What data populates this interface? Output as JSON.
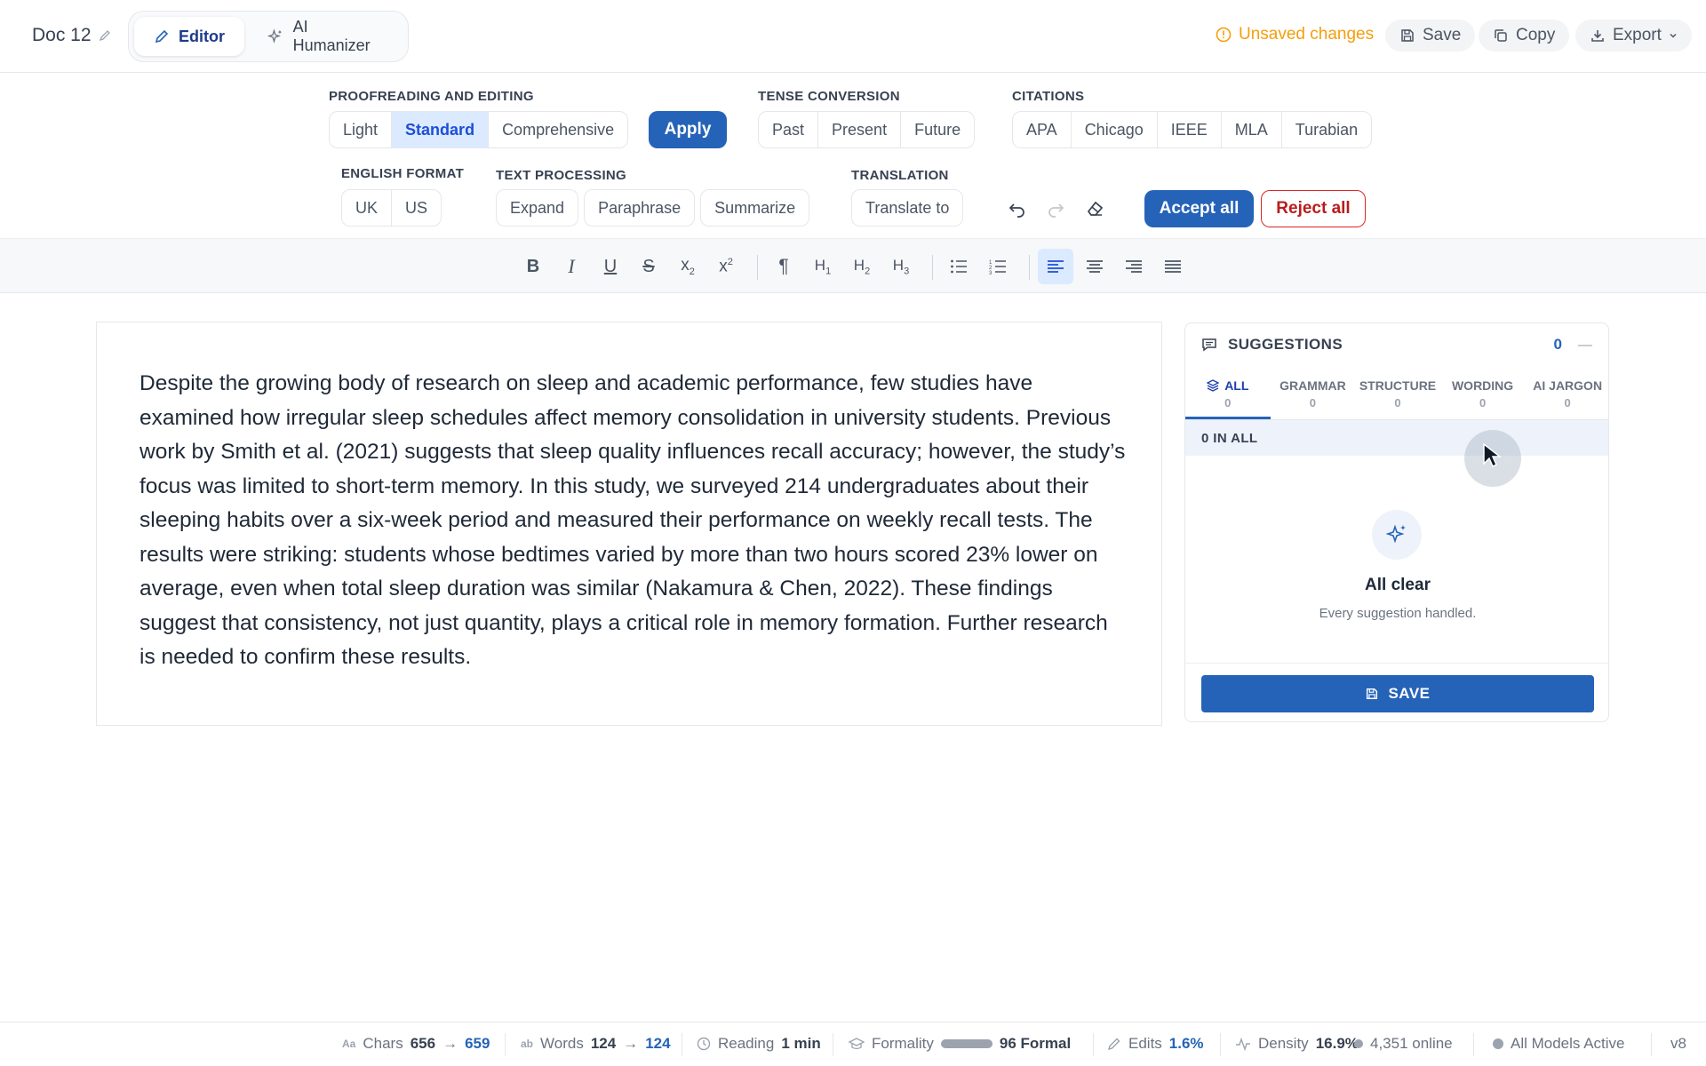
{
  "doc": {
    "title": "Doc 12"
  },
  "modes": [
    {
      "label": "Editor"
    },
    {
      "label": "AI Humanizer"
    }
  ],
  "header": {
    "unsaved": "Unsaved changes",
    "save": "Save",
    "copy": "Copy",
    "export": "Export"
  },
  "proofreading": {
    "label": "PROOFREADING AND EDITING",
    "options": [
      "Light",
      "Standard",
      "Comprehensive"
    ],
    "selected": "Standard",
    "apply": "Apply"
  },
  "tense": {
    "label": "TENSE CONVERSION",
    "options": [
      "Past",
      "Present",
      "Future"
    ]
  },
  "citations": {
    "label": "CITATIONS",
    "options": [
      "APA",
      "Chicago",
      "IEEE",
      "MLA",
      "Turabian"
    ]
  },
  "english_format": {
    "label": "ENGLISH FORMAT",
    "options": [
      "UK",
      "US"
    ]
  },
  "text_processing": {
    "label": "TEXT PROCESSING",
    "options": [
      "Expand",
      "Paraphrase",
      "Summarize"
    ]
  },
  "translation": {
    "label": "TRANSLATION",
    "button": "Translate to"
  },
  "review": {
    "accept_all": "Accept all",
    "reject_all": "Reject all"
  },
  "format_toolbar": {
    "items": [
      "bold",
      "italic",
      "underline",
      "strikethrough",
      "subscript",
      "superscript",
      "paragraph",
      "heading-1",
      "heading-2",
      "heading-3",
      "bullet-list",
      "numbered-list",
      "align-left",
      "align-center",
      "align-right",
      "align-justify"
    ],
    "active": "align-left"
  },
  "editor": {
    "text": "Despite the growing body of research on sleep and academic performance, few studies have examined how irregular sleep schedules affect memory consolidation in university students. Previous work by Smith et al. (2021) suggests that sleep quality influences recall accuracy; however, the study’s focus was limited to short-term memory. In this study, we surveyed 214 undergraduates about their sleeping habits over a six-week period and measured their performance on weekly recall tests. The results were striking: students whose bedtimes varied by more than two hours scored 23% lower on average, even when total sleep duration was similar (Nakamura & Chen, 2022). These findings suggest that consistency, not just quantity, plays a critical role in memory formation. Further research is needed to confirm these results."
  },
  "suggestions": {
    "title": "SUGGESTIONS",
    "count": "0",
    "minimize": "—",
    "tabs": [
      {
        "label": "ALL",
        "count": "0"
      },
      {
        "label": "GRAMMAR",
        "count": "0"
      },
      {
        "label": "STRUCTURE",
        "count": "0"
      },
      {
        "label": "WORDING",
        "count": "0"
      },
      {
        "label": "AI JARGON",
        "count": "0"
      }
    ],
    "in_all": "0 IN ALL",
    "empty_title": "All clear",
    "empty_sub": "Every suggestion handled.",
    "save": "SAVE"
  },
  "status": {
    "chars_label": "Chars",
    "chars_from": "656",
    "chars_to": "659",
    "words_label": "Words",
    "words_from": "124",
    "words_to": "124",
    "reading_label": "Reading",
    "reading_value": "1 min",
    "formality_label": "Formality",
    "formality_value": "96 Formal",
    "edits_label": "Edits",
    "edits_value": "1.6%",
    "density_label": "Density",
    "density_value": "16.9%",
    "online": "4,351 online",
    "models": "All Models Active",
    "version": "v8"
  },
  "colors": {
    "accent": "#2563b8",
    "warning": "#f59e0b",
    "danger": "#dc2626",
    "active_bg": "#dbeafe"
  },
  "arrow": "→"
}
